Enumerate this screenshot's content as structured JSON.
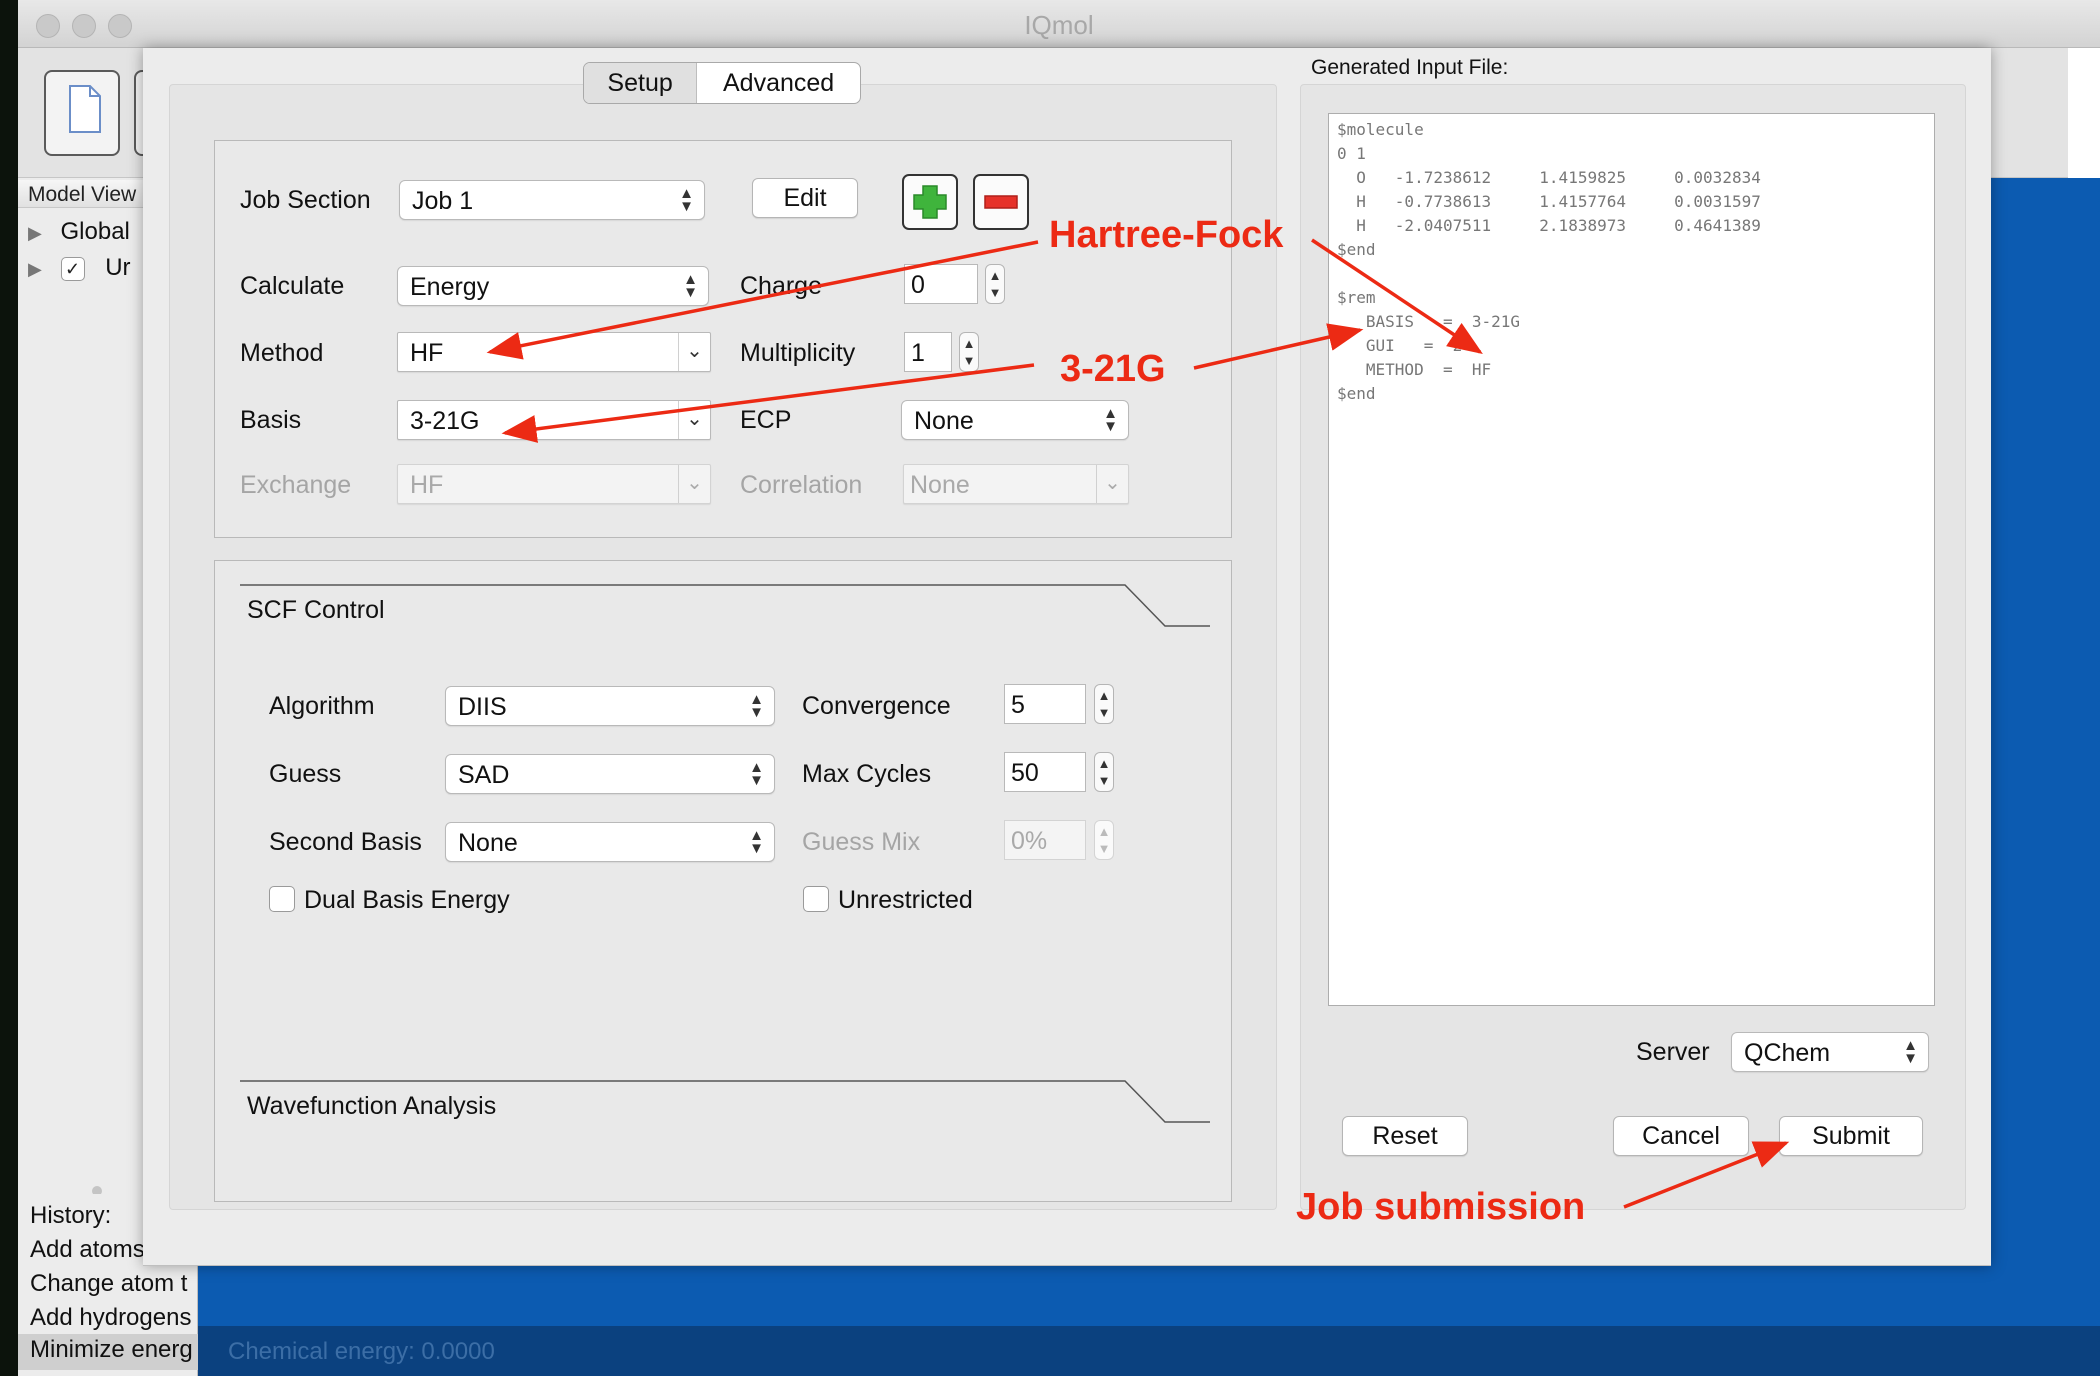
{
  "app": {
    "title": "IQmol"
  },
  "model_view": {
    "header": "Model View",
    "items": [
      {
        "label": "Global",
        "expanded": false
      },
      {
        "label": "Ur",
        "checked": true
      }
    ]
  },
  "history": {
    "title": "History:",
    "items": [
      "Add atoms",
      "Change atom t",
      "Add hydrogens",
      "Minimize energ"
    ]
  },
  "status_bar": {
    "text": "Chemical energy: 0.0000"
  },
  "dialog": {
    "tabs": [
      {
        "label": "Setup",
        "selected": true
      },
      {
        "label": "Advanced",
        "selected": false
      }
    ],
    "job": {
      "job_section_label": "Job Section",
      "job_section_value": "Job 1",
      "edit_label": "Edit",
      "add_icon": "green-plus-icon",
      "remove_icon": "red-minus-icon",
      "calculate_label": "Calculate",
      "calculate_value": "Energy",
      "charge_label": "Charge",
      "charge_value": "0",
      "method_label": "Method",
      "method_value": "HF",
      "multiplicity_label": "Multiplicity",
      "multiplicity_value": "1",
      "basis_label": "Basis",
      "basis_value": "3-21G",
      "ecp_label": "ECP",
      "ecp_value": "None",
      "exchange_label": "Exchange",
      "exchange_value": "HF",
      "correlation_label": "Correlation",
      "correlation_value": "None"
    },
    "scf": {
      "title": "SCF Control",
      "algorithm_label": "Algorithm",
      "algorithm_value": "DIIS",
      "convergence_label": "Convergence",
      "convergence_value": "5",
      "guess_label": "Guess",
      "guess_value": "SAD",
      "max_cycles_label": "Max Cycles",
      "max_cycles_value": "50",
      "second_basis_label": "Second Basis",
      "second_basis_value": "None",
      "guess_mix_label": "Guess Mix",
      "guess_mix_value": "0%",
      "dual_basis_label": "Dual Basis Energy",
      "dual_basis_checked": false,
      "unrestricted_label": "Unrestricted",
      "unrestricted_checked": false
    },
    "wavefunction": {
      "title": "Wavefunction Analysis"
    },
    "generated": {
      "title": "Generated Input File:",
      "lines": [
        "$molecule",
        "0 1",
        "  O   -1.7238612     1.4159825     0.0032834",
        "  H   -0.7738613     1.4157764     0.0031597",
        "  H   -2.0407511     2.1838973     0.4641389",
        "$end",
        "",
        "$rem",
        "   BASIS   =  3-21G",
        "   GUI   =  2",
        "   METHOD  =  HF",
        "$end"
      ]
    },
    "server_label": "Server",
    "server_value": "QChem",
    "reset_label": "Reset",
    "cancel_label": "Cancel",
    "submit_label": "Submit"
  },
  "annotations": {
    "hartree_fock": "Hartree-Fock",
    "basis": "3-21G",
    "job_submission": "Job submission",
    "color": "#ec2a14"
  }
}
